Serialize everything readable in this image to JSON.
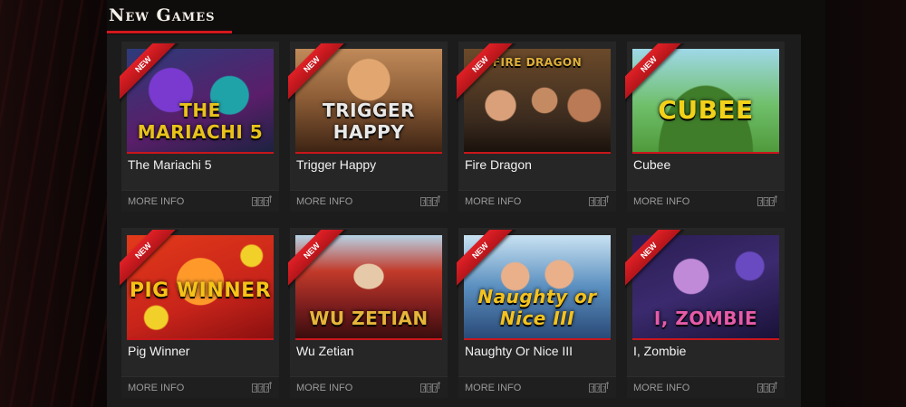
{
  "section": {
    "title": "New Games"
  },
  "ribbon_text": "NEW",
  "more_info_label": "MORE INFO",
  "games": [
    {
      "name": "The Mariachi 5",
      "logo": "THE MARIACHI 5",
      "bg": "#2d3b7a",
      "accent": "#e8c21b"
    },
    {
      "name": "Trigger Happy",
      "logo": "TRIGGER HAPPY",
      "bg": "#8a5b35",
      "accent": "#e9e9e9"
    },
    {
      "name": "Fire Dragon",
      "logo": "FIRE DRAGON",
      "bg": "#3a2a1e",
      "accent": "#e0b23a"
    },
    {
      "name": "Cubee",
      "logo": "CUBEE",
      "bg": "#4f9a3b",
      "accent": "#f2d11a"
    },
    {
      "name": "Pig Winner",
      "logo": "PIG WINNER",
      "bg": "#c8241a",
      "accent": "#f5c318"
    },
    {
      "name": "Wu Zetian",
      "logo": "WU ZETIAN",
      "bg": "#7a1d1d",
      "accent": "#e6b63a"
    },
    {
      "name": "Naughty Or Nice III",
      "logo": "Naughty or Nice III",
      "bg": "#5a8fbf",
      "accent": "#f4c21e"
    },
    {
      "name": "I, Zombie",
      "logo": "I, ZOMBIE",
      "bg": "#3b2a6e",
      "accent": "#e65ba8"
    }
  ]
}
